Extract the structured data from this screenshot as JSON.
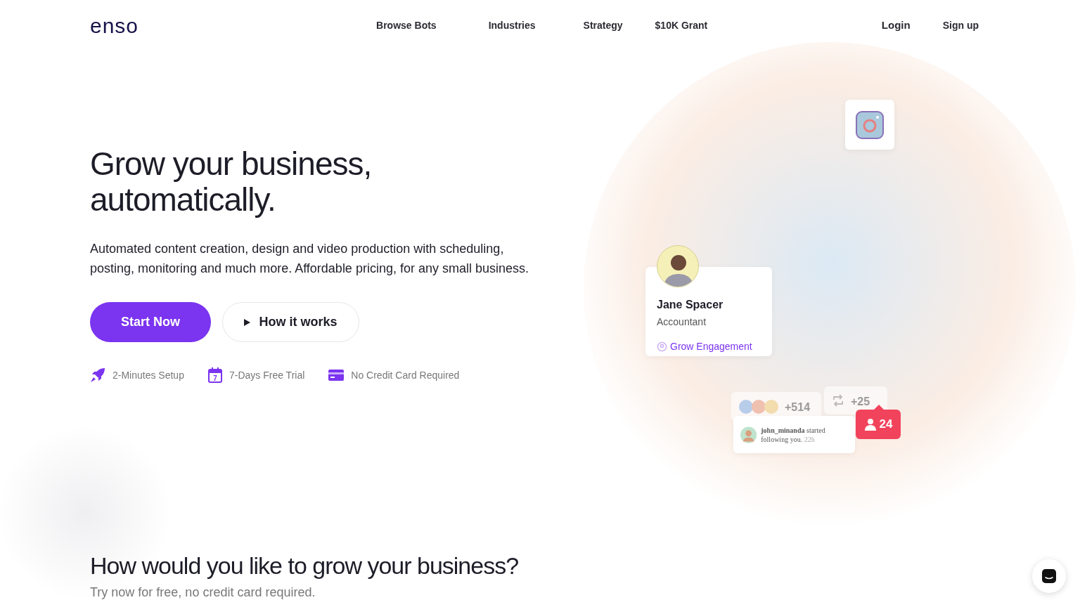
{
  "logo": "enso",
  "nav": [
    "Browse Bots",
    "Industries",
    "Strategy",
    "$10K Grant"
  ],
  "auth": {
    "login": "Login",
    "signup": "Sign up"
  },
  "hero": {
    "title": "Grow your business, automatically.",
    "text": "Automated content creation, design and video production with scheduling, posting, monitoring and much more. Affordable pricing, for any small business.",
    "primary_button": "Start Now",
    "secondary_button": "How it works",
    "features": [
      {
        "kind": "rocket",
        "label": "2-Minutes Setup"
      },
      {
        "kind": "calendar",
        "label": "7-Days Free Trial",
        "icon_text": "7"
      },
      {
        "kind": "card",
        "label": "No Credit Card Required"
      }
    ]
  },
  "profile_card": {
    "name": "Jane Spacer",
    "role": "Accountant",
    "goal": "Grow Engagement"
  },
  "stats": [
    {
      "kind": "reactions",
      "value": "+514"
    },
    {
      "kind": "repost",
      "value": "+25"
    }
  ],
  "notification": {
    "user": "john_minanda",
    "text": "started following you.",
    "time": "22h"
  },
  "follower_badge": "24",
  "section": {
    "title": "How would you like to grow your business?",
    "subtitle": "Try now for free, no credit card required."
  }
}
